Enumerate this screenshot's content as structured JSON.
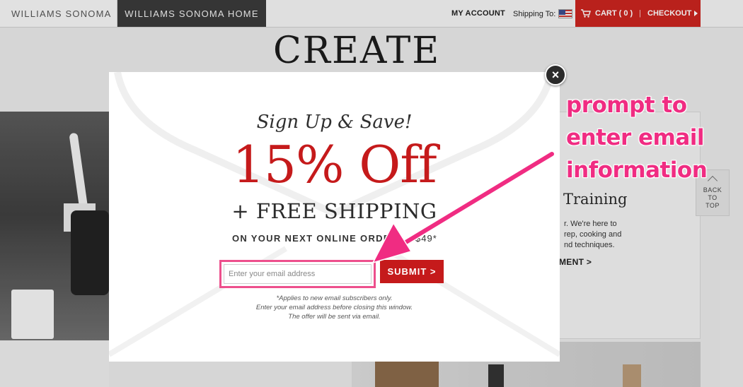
{
  "nav": {
    "brand": "WILLIAMS SONOMA",
    "brand_home": "WILLIAMS SONOMA HOME",
    "my_account": "MY ACCOUNT",
    "shipping_to": "Shipping To:",
    "cart": "CART ( 0 )",
    "separator": "|",
    "checkout": "CHECKOUT"
  },
  "page": {
    "title": "CREATE",
    "training_title": "Training",
    "training_body": "r. We're here to\nrep, cooking and\nnd techniques.",
    "training_link": "MENT >",
    "back_to_top": [
      "BACK",
      "TO",
      "TOP"
    ]
  },
  "modal": {
    "headline": "Sign Up & Save!",
    "discount": "15% Off",
    "free_shipping": "+ FREE SHIPPING",
    "next_order": "ON YOUR NEXT ONLINE ORDER",
    "next_order_tail": "$49*",
    "email_placeholder": "Enter your email address",
    "email_value": "",
    "submit": "SUBMIT >",
    "close_symbol": "×",
    "fine_print": [
      "*Applies to new email subscribers only.",
      "Enter your email address before closing this window.",
      "The offer will be sent via email."
    ]
  },
  "annotation": {
    "lines": [
      "prompt to",
      "enter email",
      "information"
    ],
    "color": "#f02c82"
  },
  "colors": {
    "brand_red": "#c51a1b",
    "nav_red": "#c9241f",
    "highlight_pink": "#ed4f8c"
  }
}
